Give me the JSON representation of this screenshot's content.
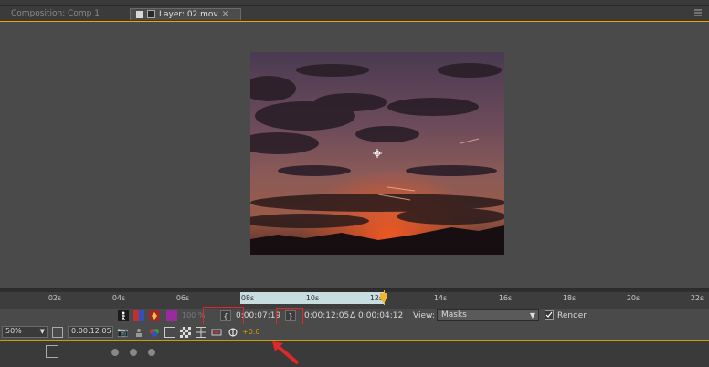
{
  "tabs": {
    "composition": "Composition: Comp 1",
    "layer": "Layer: 02.mov"
  },
  "ruler": {
    "ticks": [
      "02s",
      "04s",
      "06s",
      "08s",
      "10s",
      "12s",
      "14s",
      "16s",
      "18s",
      "20s",
      "22s"
    ]
  },
  "controls": {
    "opacity": "100 %",
    "in_time": "0:00:07:19",
    "out_time": "0:00:12:05",
    "duration": "Δ 0:00:04:12",
    "view_label": "View:",
    "view_value": "Masks",
    "render_label": "Render",
    "zoom": "50%",
    "current_time": "0:00:12:05",
    "exposure": "+0.0"
  },
  "colors": {
    "accent": "#f0a400",
    "cti": "#f2b52b",
    "highlight": "#e0282a",
    "work_area": "#c7dde0"
  }
}
